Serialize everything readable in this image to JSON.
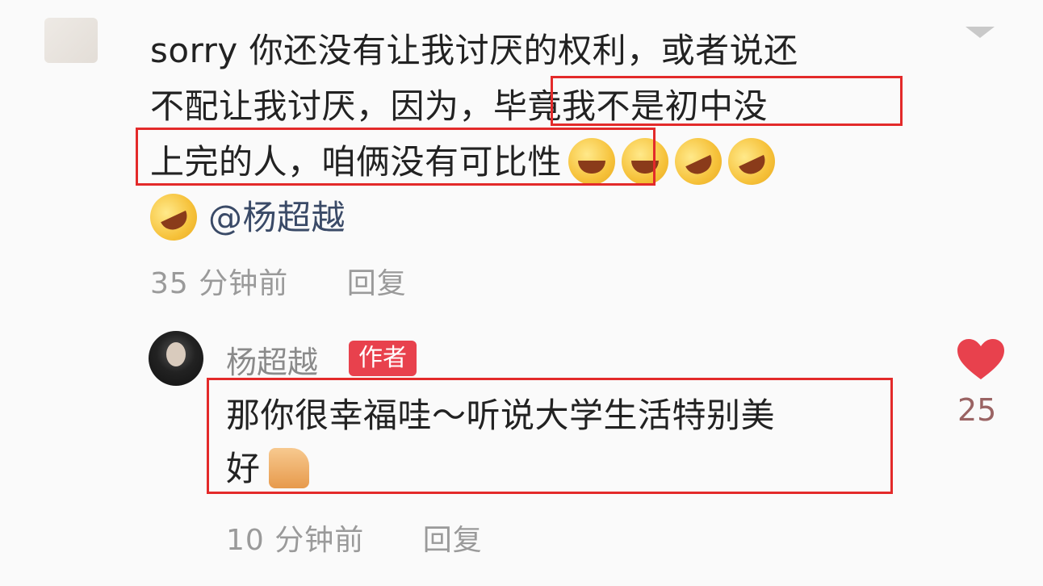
{
  "comment": {
    "lines": [
      "sorry 你还没有让我讨厌的权利，或者说还",
      "不配让我讨厌，因为，毕竟我不是初中没",
      "上完的人，咱俩没有可比性",
      "@杨超越"
    ],
    "line2_prefix": "不配让我讨厌，因为，",
    "line2_highlight": "毕竟我不是初中没",
    "line3_highlight": "上完的人，咱俩没有可比性",
    "mention": "@杨超越",
    "time": "35 分钟前",
    "reply_action": "回复"
  },
  "reply": {
    "name": "杨超越",
    "badge": "作者",
    "line1": "那你很幸福哇～听说大学生活特别美",
    "line2": "好",
    "time": "10 分钟前",
    "reply_action": "回复",
    "likes": "25"
  },
  "colors": {
    "highlight_box": "#e32a2a",
    "author_badge": "#e8414d",
    "heart": "#e8414d"
  }
}
